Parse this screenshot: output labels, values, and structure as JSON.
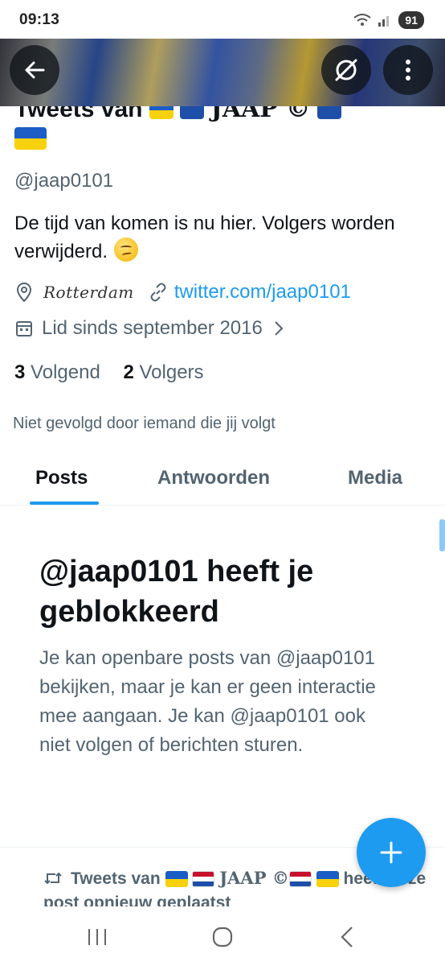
{
  "status": {
    "time": "09:13",
    "battery": "91"
  },
  "profile": {
    "name_prefix": "Tweets van",
    "name_core": "JAAP ©",
    "handle": "@jaap0101",
    "bio": "De tijd van komen is nu hier.  Volgers worden verwijderd.",
    "location": "Rotterdam",
    "link": "twitter.com/jaap0101",
    "joined": "Lid sinds september 2016",
    "following_count": "3",
    "following_label": "Volgend",
    "followers_count": "2",
    "followers_label": "Volgers",
    "not_followed": "Niet gevolgd door iemand die jij volgt"
  },
  "tabs": [
    {
      "label": "Posts",
      "active": true
    },
    {
      "label": "Antwoorden",
      "active": false
    },
    {
      "label": "Media",
      "active": false
    }
  ],
  "blocked": {
    "title": "@jaap0101 heeft je geblokkeerd",
    "text": "Je kan openbare posts van @jaap0101 bekijken, maar je kan er geen interactie mee aangaan. Je kan @jaap0101 ook niet volgen of berichten sturen."
  },
  "retweet": {
    "prefix": "Tweets van",
    "name": "JAAP ©",
    "suffix": "heeft deze post opnieuw geplaatst"
  },
  "colors": {
    "accent": "#1d9bf0",
    "text": "#0f1419",
    "muted": "#536471"
  },
  "icons": [
    "back-arrow-icon",
    "crossed-circle-icon",
    "more-vertical-icon",
    "location-pin-icon",
    "link-icon",
    "calendar-icon",
    "chevron-right-icon",
    "retweet-icon",
    "plus-icon"
  ]
}
